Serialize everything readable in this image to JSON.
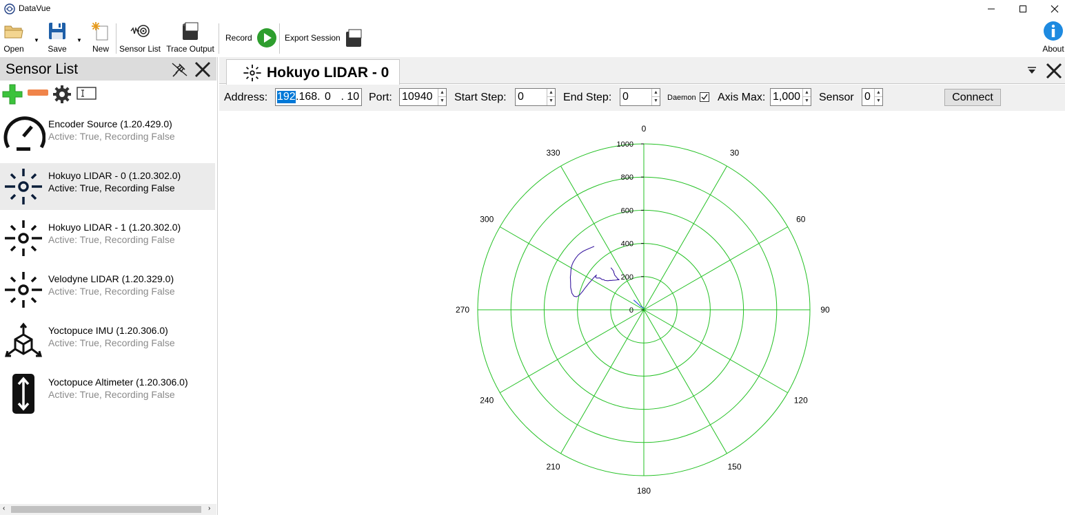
{
  "window": {
    "title": "DataVue"
  },
  "toolbar": {
    "open": "Open",
    "save": "Save",
    "new": "New",
    "sensor_list": "Sensor List",
    "trace_output": "Trace Output",
    "record": "Record",
    "export_session": "Export Session",
    "about": "About"
  },
  "sensor_list": {
    "title": "Sensor List",
    "items": [
      {
        "name": "Encoder Source (1.20.429.0)",
        "status": "Active: True, Recording False",
        "icon": "gauge-icon"
      },
      {
        "name": "Hokuyo LIDAR - 0 (1.20.302.0)",
        "status": "Active: True, Recording False",
        "icon": "lidar-icon",
        "selected": true
      },
      {
        "name": "Hokuyo LIDAR - 1 (1.20.302.0)",
        "status": "Active: True, Recording False",
        "icon": "lidar-icon"
      },
      {
        "name": "Velodyne LIDAR (1.20.329.0)",
        "status": "Active: True, Recording False",
        "icon": "lidar-icon"
      },
      {
        "name": "Yoctopuce IMU (1.20.306.0)",
        "status": "Active: True, Recording False",
        "icon": "cube-axes-icon"
      },
      {
        "name": "Yoctopuce Altimeter (1.20.306.0)",
        "status": "Active: True, Recording False",
        "icon": "altimeter-icon"
      }
    ]
  },
  "document": {
    "tab_title": "Hokuyo LIDAR - 0",
    "controls": {
      "address_label": "Address:",
      "address_parts": [
        "192",
        ".168.",
        " 0",
        " . 10"
      ],
      "port_label": "Port:",
      "port_value": "10940",
      "start_step_label": "Start Step:",
      "start_step_value": "0",
      "end_step_label": "End Step:",
      "end_step_value": "0",
      "daemon_label": "Daemon",
      "daemon_checked": true,
      "axis_max_label": "Axis Max:",
      "axis_max_value": "1,000",
      "sensor_label": "Sensor",
      "sensor_value": "0",
      "connect_label": "Connect"
    }
  },
  "chart_data": {
    "type": "polar",
    "title": "",
    "radial_max": 1000,
    "radial_ticks": [
      0,
      200,
      400,
      600,
      800,
      1000
    ],
    "angle_ticks": [
      0,
      30,
      60,
      90,
      120,
      150,
      180,
      210,
      240,
      270,
      300,
      330
    ],
    "grid": true,
    "grid_color": "#22c022",
    "series": [
      {
        "color": "#3a1aa0",
        "points": [
          [
            322,
            485
          ],
          [
            320,
            490
          ],
          [
            318,
            496
          ],
          [
            316,
            502
          ],
          [
            314,
            508
          ],
          [
            312,
            512
          ],
          [
            310,
            515
          ],
          [
            307,
            515
          ],
          [
            304,
            513
          ],
          [
            302,
            510
          ],
          [
            300,
            505
          ],
          [
            298,
            497
          ],
          [
            296,
            490
          ],
          [
            294,
            484
          ],
          [
            292,
            476
          ],
          [
            290,
            469
          ],
          [
            287,
            461
          ],
          [
            285,
            452
          ],
          [
            283,
            444
          ],
          [
            282,
            436
          ],
          [
            281,
            428
          ],
          [
            281,
            420
          ],
          [
            281,
            412
          ],
          [
            282,
            404
          ],
          [
            283,
            397
          ],
          [
            285,
            390
          ],
          [
            287,
            384
          ],
          [
            290,
            378
          ],
          [
            293,
            372
          ],
          [
            296,
            367
          ],
          [
            299,
            362
          ],
          [
            302,
            359
          ],
          [
            305,
            356
          ],
          [
            306,
            354
          ],
          [
            304,
            350
          ],
          [
            304,
            342
          ],
          [
            305,
            334
          ],
          [
            306,
            327
          ],
          [
            306,
            318
          ],
          [
            306,
            310
          ],
          [
            307,
            302
          ],
          [
            307,
            294
          ],
          [
            308,
            286
          ],
          [
            309,
            278
          ],
          [
            311,
            270
          ],
          [
            312,
            264
          ],
          [
            314,
            256
          ],
          [
            316,
            248
          ],
          [
            319,
            240
          ],
          [
            320,
            236
          ],
          [
            321,
            234
          ],
          [
            320,
            240
          ],
          [
            320,
            245
          ],
          [
            320,
            250
          ],
          [
            320,
            256
          ],
          [
            320,
            263
          ],
          [
            320,
            268
          ],
          [
            320,
            275
          ],
          [
            321,
            282
          ],
          [
            321,
            288
          ],
          [
            322,
            293
          ],
          [
            322,
            298
          ],
          [
            322,
            304
          ],
          [
            322,
            309
          ],
          [
            322,
            314
          ],
          [
            322,
            318
          ],
          [
            322,
            322
          ]
        ]
      },
      {
        "color": "#2244dd",
        "points": [
          [
            314,
            85
          ],
          [
            315,
            60
          ],
          [
            316,
            40
          ],
          [
            318,
            25
          ],
          [
            5,
            10
          ]
        ]
      }
    ]
  }
}
